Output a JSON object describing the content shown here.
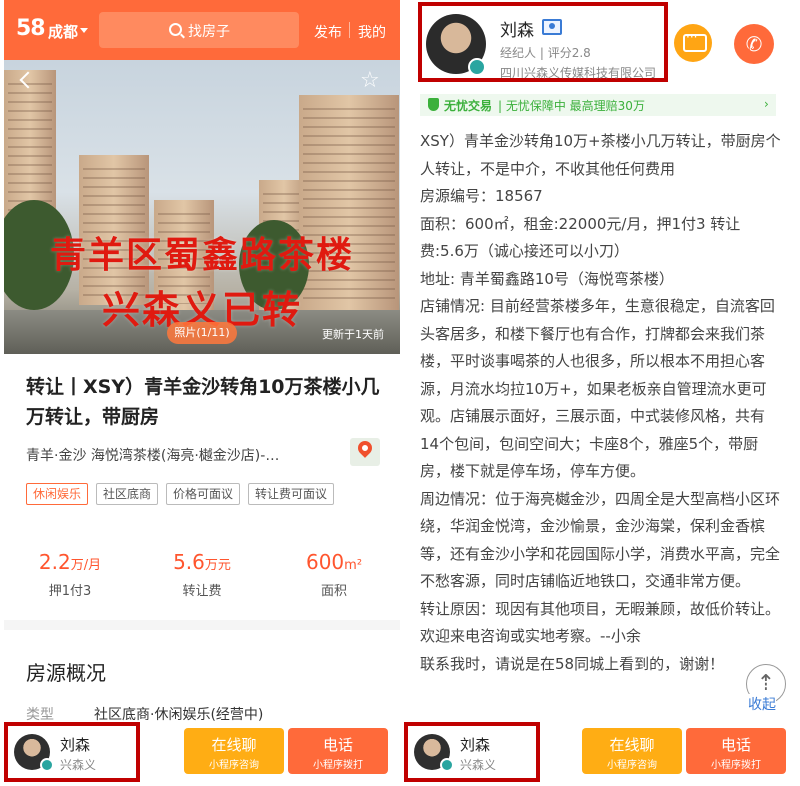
{
  "left": {
    "topbar": {
      "logo": "58",
      "city": "成都",
      "search_placeholder": "找房子",
      "link_publish": "发布",
      "link_mine": "我的"
    },
    "photo": {
      "overlay_line1": "青羊区蜀鑫路茶楼",
      "overlay_line2": "兴森义已转",
      "counter": "照片(1/11)",
      "updated": "更新于1天前"
    },
    "listing": {
      "title": "转让丨XSY）青羊金沙转角10万茶楼小几万转让，带厨房",
      "address": "青羊·金沙 海悦湾茶楼(海亮·樾金沙店)-…",
      "tags": [
        {
          "label": "休闲娱乐",
          "highlight": true
        },
        {
          "label": "社区底商",
          "highlight": false
        },
        {
          "label": "价格可面议",
          "highlight": false
        },
        {
          "label": "转让费可面议",
          "highlight": false
        }
      ],
      "stats": [
        {
          "value": "2.2",
          "unit": "万/月",
          "label": "押1付3"
        },
        {
          "value": "5.6",
          "unit": "万元",
          "label": "转让费"
        },
        {
          "value": "600",
          "unit": "m²",
          "label": "面积"
        }
      ]
    },
    "overview": {
      "title": "房源概况",
      "type_label": "类型",
      "type_value": "社区底商·休闲娱乐(经营中)"
    },
    "bottom": {
      "agent_name": "刘森",
      "agent_sub": "兴森义",
      "chat_label": "在线聊",
      "chat_sub": "小程序咨询",
      "call_label": "电话",
      "call_sub": "小程序拨打"
    }
  },
  "right": {
    "header": {
      "agent_name": "刘森",
      "role": "经纪人",
      "rating": "评分2.8",
      "company": "四川兴森义传媒科技有限公司"
    },
    "banner": {
      "brand": "无忧交易",
      "text": "无忧保障中 最高理赔30万"
    },
    "description": [
      "XSY）青羊金沙转角10万+茶楼小几万转让，带厨房个人转让，不是中介，不收其他任何费用",
      "房源编号：18567",
      "面积：600㎡，租金:22000元/月，押1付3 转让费:5.6万（诚心接还可以小刀）",
      "地址: 青羊蜀鑫路10号（海悦弯茶楼）",
      "店铺情况: 目前经营茶楼多年，生意很稳定，自流客回头客居多，和楼下餐厅也有合作，打牌都会来我们茶楼，平时谈事喝茶的人也很多，所以根本不用担心客源，月流水均拉10万+，如果老板亲自管理流水更可观。店铺展示面好，三展示面，中式装修风格，共有14个包间，包间空间大；卡座8个，雅座5个，带厨房，楼下就是停车场，停车方便。",
      "周边情况：位于海亮樾金沙，四周全是大型高档小区环绕，华润金悦湾，金沙愉景，金沙海棠，保利金香槟等，还有金沙小学和花园国际小学，消费水平高，完全不愁客源，同时店铺临近地铁口，交通非常方便。",
      "转让原因：现因有其他项目，无暇兼顾，故低价转让。欢迎来电咨询或实地考察。--小余",
      "联系我时，请说是在58同城上看到的，谢谢！"
    ],
    "collapse": "收起",
    "bottom": {
      "agent_name": "刘森",
      "agent_sub": "兴森义",
      "chat_label": "在线聊",
      "chat_sub": "小程序咨询",
      "call_label": "电话",
      "call_sub": "小程序拨打"
    }
  },
  "colors": {
    "brand_orange": "#ff6a3a",
    "chat_yellow": "#ffad14",
    "highlight_red": "#c00000",
    "price_red": "#ff552e",
    "safe_green": "#3bb03b"
  }
}
